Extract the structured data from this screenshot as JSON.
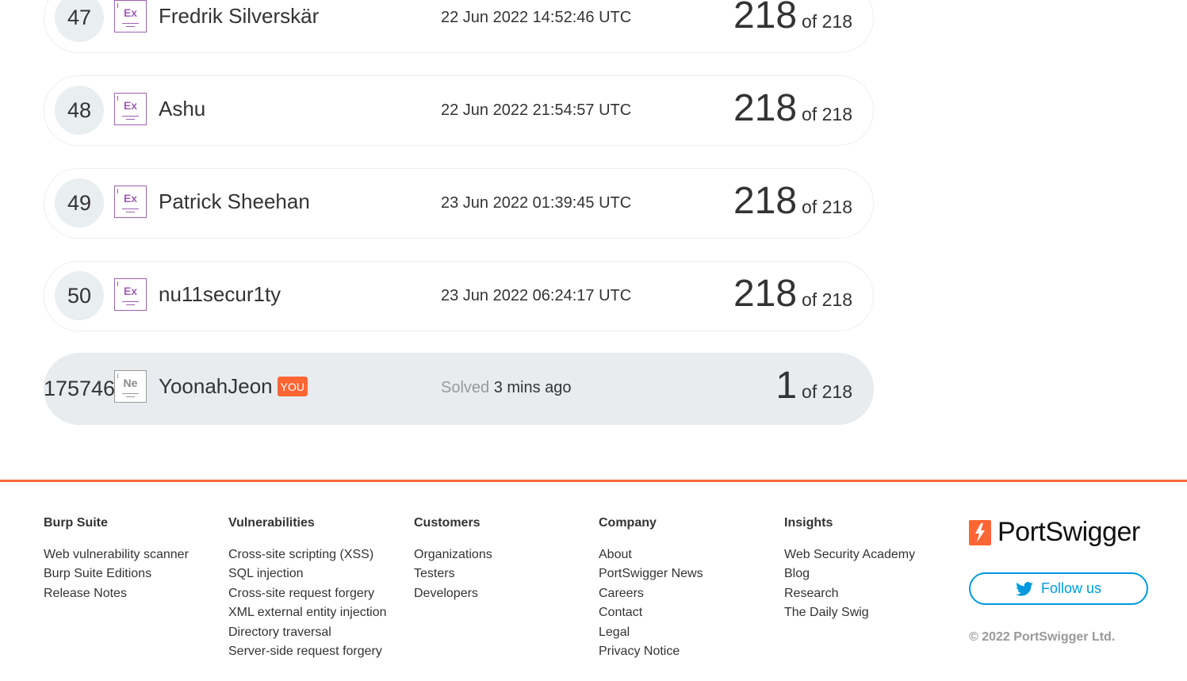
{
  "leaderboard": {
    "rows": [
      {
        "rank": "47",
        "badge": "Ex",
        "name": "Fredrik Silverskär",
        "date": "22 Jun 2022 14:52:46 UTC",
        "score": "218",
        "total": "of 218"
      },
      {
        "rank": "48",
        "badge": "Ex",
        "name": "Ashu",
        "date": "22 Jun 2022 21:54:57 UTC",
        "score": "218",
        "total": "of 218"
      },
      {
        "rank": "49",
        "badge": "Ex",
        "name": "Patrick Sheehan",
        "date": "23 Jun 2022 01:39:45 UTC",
        "score": "218",
        "total": "of 218"
      },
      {
        "rank": "50",
        "badge": "Ex",
        "name": "nu11secur1ty",
        "date": "23 Jun 2022 06:24:17 UTC",
        "score": "218",
        "total": "of 218"
      }
    ],
    "me": {
      "rank": "175746",
      "badge": "Ne",
      "name": "YoonahJeon",
      "you_label": "YOU",
      "solved_label": "Solved",
      "solved_time": "3 mins ago",
      "score": "1",
      "total": "of 218"
    }
  },
  "footer": {
    "columns": [
      {
        "title": "Burp Suite",
        "links": [
          "Web vulnerability scanner",
          "Burp Suite Editions",
          "Release Notes"
        ]
      },
      {
        "title": "Vulnerabilities",
        "links": [
          "Cross-site scripting (XSS)",
          "SQL injection",
          "Cross-site request forgery",
          "XML external entity injection",
          "Directory traversal",
          "Server-side request forgery"
        ]
      },
      {
        "title": "Customers",
        "links": [
          "Organizations",
          "Testers",
          "Developers"
        ]
      },
      {
        "title": "Company",
        "links": [
          "About",
          "PortSwigger News",
          "Careers",
          "Contact",
          "Legal",
          "Privacy Notice"
        ]
      },
      {
        "title": "Insights",
        "links": [
          "Web Security Academy",
          "Blog",
          "Research",
          "The Daily Swig"
        ]
      }
    ],
    "logo_text": "PortSwigger",
    "follow_label": "Follow us",
    "follow_icon": "twitter-icon",
    "copyright": "© 2022 PortSwigger Ltd."
  },
  "colors": {
    "accent": "#ff6633",
    "twitter": "#0099dd",
    "expert_badge": "#a05fb5"
  }
}
